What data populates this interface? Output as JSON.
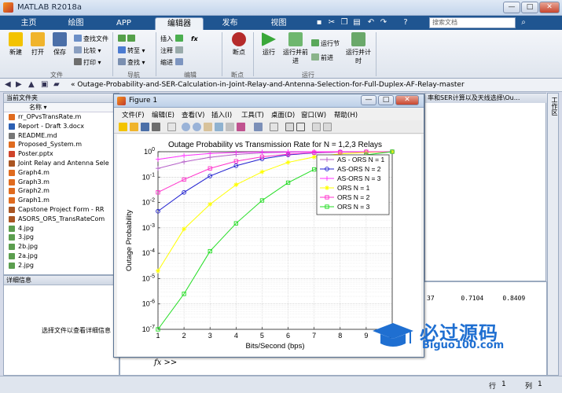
{
  "window": {
    "title": "MATLAB R2018a",
    "min": "—",
    "max": "□",
    "close": "✕"
  },
  "ribbon_tabs": [
    "主页",
    "绘图",
    "APP",
    "编辑器",
    "发布",
    "视图"
  ],
  "search": {
    "placeholder": "搜索文档"
  },
  "ribbon": {
    "file": {
      "new": "新建",
      "open": "打开",
      "save": "保存",
      "find_files": "查找文件",
      "compare": "比较",
      "print": "打印",
      "group": "文件"
    },
    "navigate": {
      "goto": "转至",
      "find": "查找",
      "group": "导航"
    },
    "edit": {
      "insert": "插入",
      "fx": "fx",
      "comment": "注释",
      "indent": "缩进",
      "group": "编辑"
    },
    "breakpoints": {
      "label": "断点",
      "group": "断点"
    },
    "run": {
      "run": "运行",
      "run_advance": "运行并前进",
      "run_section": "运行节",
      "advance": "前进",
      "run_time": "运行并计时",
      "group": "运行"
    }
  },
  "address": {
    "path": "« Outage-Probability-and-SER-Calculation-in-Joint-Relay-and-Antenna-Selection-for-Full-Duplex-AF-Relay-master"
  },
  "files": {
    "panel_title": "当前文件夹",
    "column": "名称 ▾",
    "items": [
      "rr_OPvsTransRate.m",
      "Report - Draft 3.docx",
      "README.md",
      "Proposed_System.m",
      "Poster.pptx",
      "Joint Relay and Antenna Sele",
      "Graph4.m",
      "Graph3.m",
      "Graph2.m",
      "Graph1.m",
      "Capstone Project Form - RR",
      "ASORS_ORS_TransRateCom",
      "4.jpg",
      "3.jpg",
      "2b.jpg",
      "2a.jpg",
      "2.jpg"
    ]
  },
  "details": {
    "title": "详细信息",
    "hint": "选择文件以查看详细信息"
  },
  "right_panel": {
    "title": "率和SER计算以及天线选择\\Ou..."
  },
  "workspace": {
    "label": "工作区"
  },
  "command": {
    "values": "37       0.7104     0.8409",
    "prompt": "fx >>"
  },
  "status": {
    "row_label": "行",
    "row": "1",
    "col_label": "列",
    "col": "1"
  },
  "figure": {
    "title": "Figure 1",
    "menus": [
      "文件(F)",
      "编辑(E)",
      "查看(V)",
      "插入(I)",
      "工具(T)",
      "桌面(D)",
      "窗口(W)",
      "帮助(H)"
    ],
    "win_min": "—",
    "win_max": "□",
    "win_close": "✕"
  },
  "chart_data": {
    "type": "line",
    "title": "Outage Probability vs Transmission Rate for N = 1,2,3 Relays",
    "xlabel": "Bits/Second (bps)",
    "ylabel": "Outage Probability",
    "xlim": [
      1,
      10
    ],
    "ylim": [
      1e-07,
      1
    ],
    "yscale": "log",
    "grid": true,
    "legend_position": "top-right",
    "x": [
      1,
      2,
      3,
      4,
      5,
      6,
      7,
      8,
      9,
      10
    ],
    "x_ticks": [
      "1",
      "2",
      "3",
      "4",
      "5",
      "6",
      "7",
      "8",
      "9",
      "10"
    ],
    "y_ticks": [
      "10^0",
      "10^-1",
      "10^-2",
      "10^-3",
      "10^-4",
      "10^-5",
      "10^-6",
      "10^-7"
    ],
    "series": [
      {
        "name": "AS - ORS N = 1",
        "color": "#b45fc8",
        "marker": "plus",
        "values": [
          0.22,
          0.4,
          0.6,
          0.78,
          0.9,
          0.96,
          0.985,
          0.995,
          0.999,
          1.0
        ]
      },
      {
        "name": "AS-ORS N = 2",
        "color": "#2020d0",
        "marker": "circle",
        "values": [
          0.0045,
          0.025,
          0.11,
          0.28,
          0.52,
          0.75,
          0.9,
          0.97,
          0.99,
          1.0
        ]
      },
      {
        "name": "AS-ORS N = 3",
        "color": "#ff30ff",
        "marker": "plus",
        "values": [
          0.5,
          0.7,
          0.85,
          0.93,
          0.97,
          0.99,
          0.996,
          0.999,
          1.0,
          1.0
        ]
      },
      {
        "name": "ORS N = 1",
        "color": "#ffff00",
        "marker": "star",
        "values": [
          2e-05,
          0.0009,
          0.0085,
          0.05,
          0.16,
          0.38,
          0.62,
          0.82,
          0.94,
          1.0
        ]
      },
      {
        "name": "ORS N = 2",
        "color": "#ff33cc",
        "marker": "square",
        "values": [
          0.025,
          0.08,
          0.22,
          0.42,
          0.63,
          0.8,
          0.92,
          0.97,
          0.99,
          1.0
        ]
      },
      {
        "name": "ORS N = 3",
        "color": "#22dd22",
        "marker": "square",
        "values": [
          8e-08,
          2.5e-06,
          0.00012,
          0.0015,
          0.012,
          0.06,
          0.2,
          0.45,
          0.75,
          1.0
        ]
      }
    ]
  },
  "watermark": {
    "cn": "必过源码",
    "url": "Biguo100.com"
  }
}
